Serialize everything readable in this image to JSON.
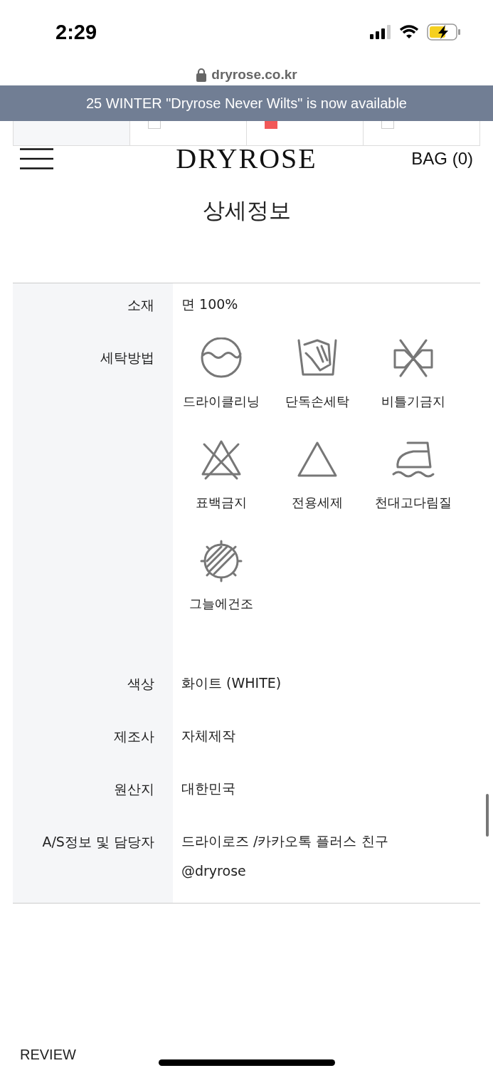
{
  "status_bar": {
    "time": "2:29"
  },
  "url_bar": {
    "url": "dryrose.co.kr"
  },
  "banner": {
    "text": "25 WINTER \"Dryrose Never Wilts\" is now available"
  },
  "filter_row": {
    "options": [
      {
        "kind": "header"
      },
      {
        "kind": "option",
        "selected": false
      },
      {
        "kind": "option",
        "selected": true
      },
      {
        "kind": "option",
        "selected": false
      }
    ]
  },
  "header": {
    "logo": "DRYROSE",
    "bag": "BAG (0)"
  },
  "section_title": "상세정보",
  "details": [
    {
      "kind": "text",
      "label": "소재",
      "value": "면 100%"
    },
    {
      "kind": "care",
      "label": "세탁방법",
      "items": [
        {
          "kind": "dryclean",
          "label": "드라이클리닝"
        },
        {
          "kind": "handwash",
          "label": "단독손세탁"
        },
        {
          "kind": "nowring",
          "label": "비틀기금지"
        },
        {
          "kind": "nobleach",
          "label": "표백금지"
        },
        {
          "kind": "bleach",
          "label": "전용세제"
        },
        {
          "kind": "iron",
          "label": "천대고다림질"
        },
        {
          "kind": "shadedry",
          "label": "그늘에건조"
        }
      ]
    },
    {
      "kind": "text",
      "label": "색상",
      "value": "화이트 (WHITE)"
    },
    {
      "kind": "text",
      "label": "제조사",
      "value": "자체제작"
    },
    {
      "kind": "text",
      "label": "원산지",
      "value": "대한민국"
    },
    {
      "kind": "multi",
      "label": "A/S정보 및 담당자",
      "lines": [
        "드라이로즈 /카카오톡 플러스 친구",
        "@dryrose"
      ]
    }
  ],
  "next_section": "REVIEW"
}
